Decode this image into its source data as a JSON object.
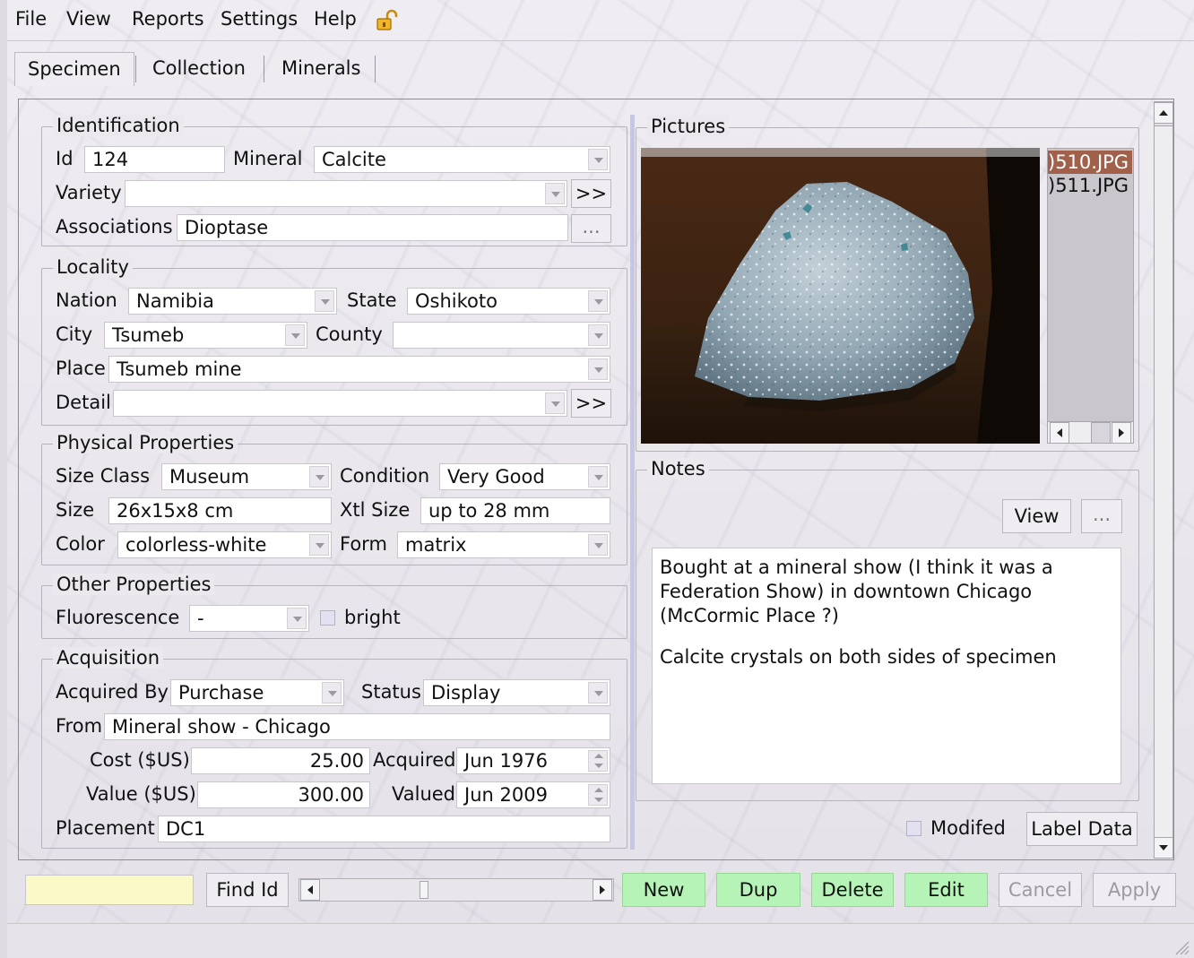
{
  "menu": {
    "items": [
      "File",
      "View",
      "Reports",
      "Settings",
      "Help"
    ],
    "lock_icon": "lock-open-icon"
  },
  "tabs": [
    "Specimen",
    "Collection",
    "Minerals"
  ],
  "identification": {
    "title": "Identification",
    "id_label": "Id",
    "id_value": "124",
    "mineral_label": "Mineral",
    "mineral_value": "Calcite",
    "variety_label": "Variety",
    "variety_value": "",
    "variety_more": ">>",
    "associations_label": "Associations",
    "associations_value": "Dioptase",
    "associations_browse": "..."
  },
  "locality": {
    "title": "Locality",
    "nation_label": "Nation",
    "nation_value": "Namibia",
    "state_label": "State",
    "state_value": "Oshikoto",
    "city_label": "City",
    "city_value": "Tsumeb",
    "county_label": "County",
    "county_value": "",
    "place_label": "Place",
    "place_value": "Tsumeb mine",
    "detail_label": "Detail",
    "detail_value": "",
    "detail_more": ">>"
  },
  "physical": {
    "title": "Physical Properties",
    "size_class_label": "Size Class",
    "size_class_value": "Museum",
    "condition_label": "Condition",
    "condition_value": "Very Good",
    "size_label": "Size",
    "size_value": "26x15x8 cm",
    "xtl_size_label": "Xtl Size",
    "xtl_size_value": "up to 28 mm",
    "color_label": "Color",
    "color_value": "colorless-white",
    "form_label": "Form",
    "form_value": "matrix"
  },
  "other": {
    "title": "Other Properties",
    "fluorescence_label": "Fluorescence",
    "fluorescence_value": "-",
    "bright_label": "bright"
  },
  "acquisition": {
    "title": "Acquisition",
    "acquired_by_label": "Acquired By",
    "acquired_by_value": "Purchase",
    "status_label": "Status",
    "status_value": "Display",
    "from_label": "From",
    "from_value": "Mineral show - Chicago",
    "cost_label": "Cost ($US)",
    "cost_value": "25.00",
    "acquired_label": "Acquired",
    "acquired_value": "Jun 1976",
    "value_label": "Value ($US)",
    "value_value": "300.00",
    "valued_label": "Valued",
    "valued_value": "Jun 2009",
    "placement_label": "Placement",
    "placement_value": "DC1"
  },
  "pictures": {
    "title": "Pictures",
    "files": [
      ")510.JPG",
      ")511.JPG"
    ]
  },
  "notes": {
    "title": "Notes",
    "view_button": "View",
    "browse_button": "...",
    "paragraphs": [
      "Bought at a mineral show (I think it was a Federation Show) in downtown Chicago (McCormic Place ?)",
      "Calcite crystals on both sides of specimen"
    ]
  },
  "footer_right": {
    "modified_label": "Modifed",
    "label_data_button": "Label Data"
  },
  "bottom_bar": {
    "find_input_value": "",
    "find_button": "Find Id",
    "new": "New",
    "dup": "Dup",
    "delete": "Delete",
    "edit": "Edit",
    "cancel": "Cancel",
    "apply": "Apply"
  },
  "colors": {
    "action_green": "#b6f3b6",
    "find_input_bg": "#fbf9c7",
    "selection": "#a0604a"
  }
}
